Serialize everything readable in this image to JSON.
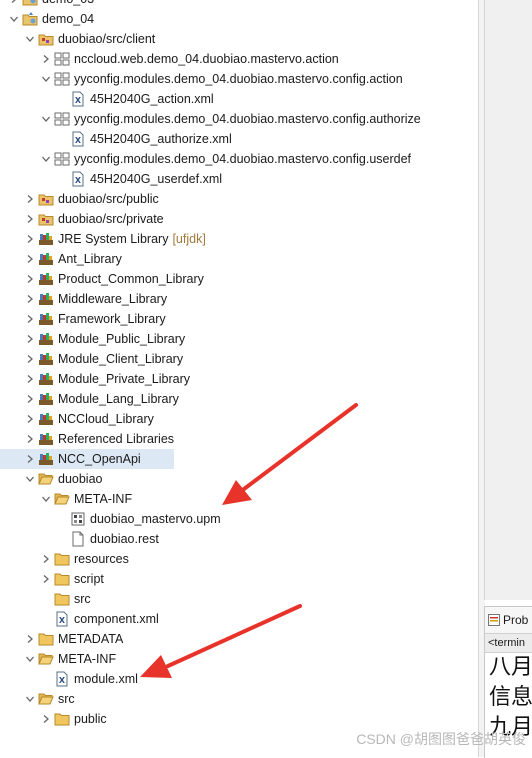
{
  "tree": [
    {
      "label": "demo_03",
      "icon": "project-icon",
      "twisty": "right",
      "indent": 0
    },
    {
      "label": "demo_04",
      "icon": "project-icon",
      "twisty": "down",
      "indent": 0
    },
    {
      "label": "duobiao/src/client",
      "icon": "source-folder-icon",
      "twisty": "down",
      "indent": 1
    },
    {
      "label": "nccloud.web.demo_04.duobiao.mastervo.action",
      "icon": "package-icon",
      "twisty": "right",
      "indent": 2
    },
    {
      "label": "yyconfig.modules.demo_04.duobiao.mastervo.config.action",
      "icon": "package-icon",
      "twisty": "down",
      "indent": 2
    },
    {
      "label": "45H2040G_action.xml",
      "icon": "xml-file-icon",
      "twisty": "none",
      "indent": 3
    },
    {
      "label": "yyconfig.modules.demo_04.duobiao.mastervo.config.authorize",
      "icon": "package-icon",
      "twisty": "down",
      "indent": 2
    },
    {
      "label": "45H2040G_authorize.xml",
      "icon": "xml-file-icon",
      "twisty": "none",
      "indent": 3
    },
    {
      "label": "yyconfig.modules.demo_04.duobiao.mastervo.config.userdef",
      "icon": "package-icon",
      "twisty": "down",
      "indent": 2
    },
    {
      "label": "45H2040G_userdef.xml",
      "icon": "xml-file-icon",
      "twisty": "none",
      "indent": 3
    },
    {
      "label": "duobiao/src/public",
      "icon": "source-folder-icon",
      "twisty": "right",
      "indent": 1
    },
    {
      "label": "duobiao/src/private",
      "icon": "source-folder-icon",
      "twisty": "right",
      "indent": 1
    },
    {
      "label": "JRE System Library",
      "decoration": "[ufjdk]",
      "icon": "library-icon",
      "twisty": "right",
      "indent": 1
    },
    {
      "label": "Ant_Library",
      "icon": "library-icon",
      "twisty": "right",
      "indent": 1
    },
    {
      "label": "Product_Common_Library",
      "icon": "library-icon",
      "twisty": "right",
      "indent": 1
    },
    {
      "label": "Middleware_Library",
      "icon": "library-icon",
      "twisty": "right",
      "indent": 1
    },
    {
      "label": "Framework_Library",
      "icon": "library-icon",
      "twisty": "right",
      "indent": 1
    },
    {
      "label": "Module_Public_Library",
      "icon": "library-icon",
      "twisty": "right",
      "indent": 1
    },
    {
      "label": "Module_Client_Library",
      "icon": "library-icon",
      "twisty": "right",
      "indent": 1
    },
    {
      "label": "Module_Private_Library",
      "icon": "library-icon",
      "twisty": "right",
      "indent": 1
    },
    {
      "label": "Module_Lang_Library",
      "icon": "library-icon",
      "twisty": "right",
      "indent": 1
    },
    {
      "label": "NCCloud_Library",
      "icon": "library-icon",
      "twisty": "right",
      "indent": 1
    },
    {
      "label": "Referenced Libraries",
      "icon": "library-icon",
      "twisty": "right",
      "indent": 1
    },
    {
      "label": "NCC_OpenApi",
      "icon": "library-icon",
      "twisty": "right",
      "indent": 1,
      "selected": true
    },
    {
      "label": "duobiao",
      "icon": "folder-open-icon",
      "twisty": "down",
      "indent": 1
    },
    {
      "label": "META-INF",
      "icon": "folder-open-icon",
      "twisty": "down",
      "indent": 2
    },
    {
      "label": "duobiao_mastervo.upm",
      "icon": "upm-file-icon",
      "twisty": "none",
      "indent": 3
    },
    {
      "label": "duobiao.rest",
      "icon": "file-icon",
      "twisty": "none",
      "indent": 3
    },
    {
      "label": "resources",
      "icon": "folder-icon",
      "twisty": "right",
      "indent": 2
    },
    {
      "label": "script",
      "icon": "folder-icon",
      "twisty": "right",
      "indent": 2
    },
    {
      "label": "src",
      "icon": "folder-icon",
      "twisty": "none",
      "indent": 2
    },
    {
      "label": "component.xml",
      "icon": "xml-file-icon",
      "twisty": "none",
      "indent": 2
    },
    {
      "label": "METADATA",
      "icon": "folder-icon",
      "twisty": "right",
      "indent": 1
    },
    {
      "label": "META-INF",
      "icon": "folder-open-icon",
      "twisty": "down",
      "indent": 1
    },
    {
      "label": "module.xml",
      "icon": "xml-file-icon",
      "twisty": "none",
      "indent": 2
    },
    {
      "label": "src",
      "icon": "folder-open-icon",
      "twisty": "down",
      "indent": 1
    },
    {
      "label": "public",
      "icon": "folder-icon",
      "twisty": "right",
      "indent": 2
    }
  ],
  "right_panel": {
    "tab_label": "Prob",
    "terminated_text": "<termin",
    "lines": [
      "八月",
      "信息",
      "九月"
    ]
  },
  "watermark": "CSDN @胡图图爸爸胡英俊",
  "colors": {
    "arrow": "#e8332a",
    "selection": "#dde8f5",
    "decoration": "#a07a3c"
  }
}
